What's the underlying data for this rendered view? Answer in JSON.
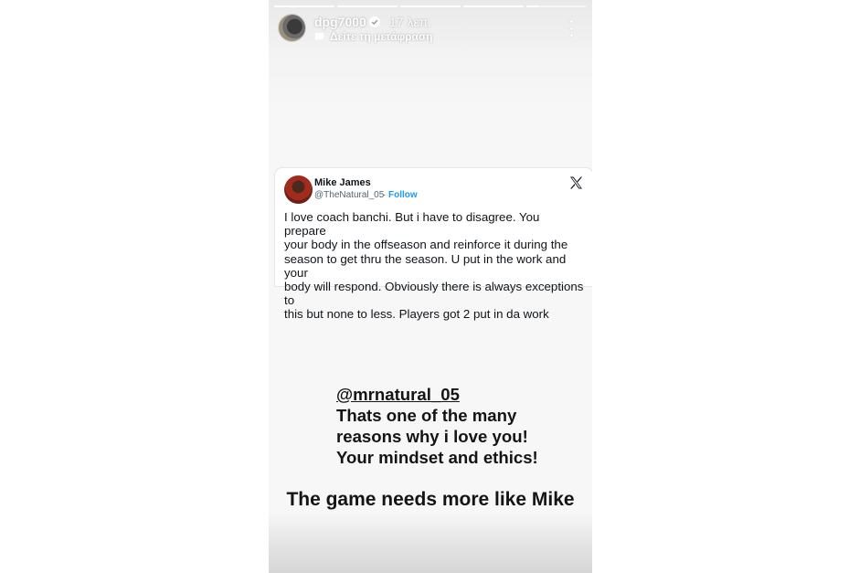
{
  "story": {
    "progress": {
      "segments": 5,
      "completed": 4,
      "current_progress": 0.2
    },
    "header": {
      "username": "dpg7000",
      "time": "17 λεπ.",
      "translate_label": "Δείτε τη μετάφραση",
      "icons": [
        "verified-icon",
        "translate-icon",
        "more-icon"
      ]
    },
    "tweet": {
      "name": "Mike James",
      "handle": "@TheNatural_05",
      "separator": "·",
      "follow_label": "Follow",
      "lines": [
        "I love coach banchi. But i have to disagree. You prepare",
        "your body in the offseason and reinforce it during the",
        "season to get thru the season. U put in the work and your",
        "body will respond. Obviously there is always exceptions to",
        "this but none to less. Players got 2 put in da work"
      ]
    },
    "caption": {
      "mention": "@mrnatural_05",
      "lines": [
        "Thats one of the many",
        "reasons why i love you!",
        "Your mindset and ethics!"
      ],
      "closing": "The game needs more like Mike"
    }
  },
  "colors": {
    "follow": "#1d9bf0",
    "text": "#0f1419",
    "caption": "#141414"
  }
}
